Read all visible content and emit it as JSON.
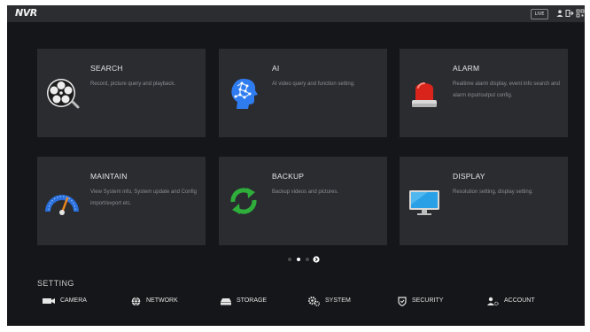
{
  "topbar": {
    "brand": "NVR",
    "live_label": "LIVE",
    "icons": [
      "user-icon",
      "logout-icon",
      "qr-code-icon"
    ]
  },
  "cards": [
    {
      "id": "search",
      "title": "SEARCH",
      "description": "Record, picture query and playback.",
      "icon": "film-reel-icon"
    },
    {
      "id": "ai",
      "title": "AI",
      "description": "AI video query and function setting.",
      "icon": "ai-brain-icon"
    },
    {
      "id": "alarm",
      "title": "ALARM",
      "description": "Realtime alarm display, event info search and alarm input/output config.",
      "icon": "alarm-beacon-icon"
    },
    {
      "id": "maintain",
      "title": "MAINTAIN",
      "description": "View System info, System update and Config import/export etc.",
      "icon": "gauge-icon"
    },
    {
      "id": "backup",
      "title": "BACKUP",
      "description": "Backup videos and pictures.",
      "icon": "backup-arrows-icon"
    },
    {
      "id": "display",
      "title": "DISPLAY",
      "description": "Resolution setting, display setting.",
      "icon": "monitor-icon"
    }
  ],
  "pager": {
    "pages": 3,
    "current": 1
  },
  "setting": {
    "title": "SETTING",
    "items": [
      {
        "label": "CAMERA",
        "icon": "camera-icon"
      },
      {
        "label": "NETWORK",
        "icon": "network-icon"
      },
      {
        "label": "STORAGE",
        "icon": "storage-icon"
      },
      {
        "label": "SYSTEM",
        "icon": "system-gears-icon"
      },
      {
        "label": "SECURITY",
        "icon": "shield-icon"
      },
      {
        "label": "ACCOUNT",
        "icon": "account-icon"
      }
    ]
  },
  "colors": {
    "screen_bg": "#151619",
    "card_bg": "#2b2c30",
    "topbar_bg": "#2b2d31",
    "alarm_red": "#d9241c",
    "backup_green": "#2fae3b",
    "ai_blue": "#2f7cf0"
  }
}
